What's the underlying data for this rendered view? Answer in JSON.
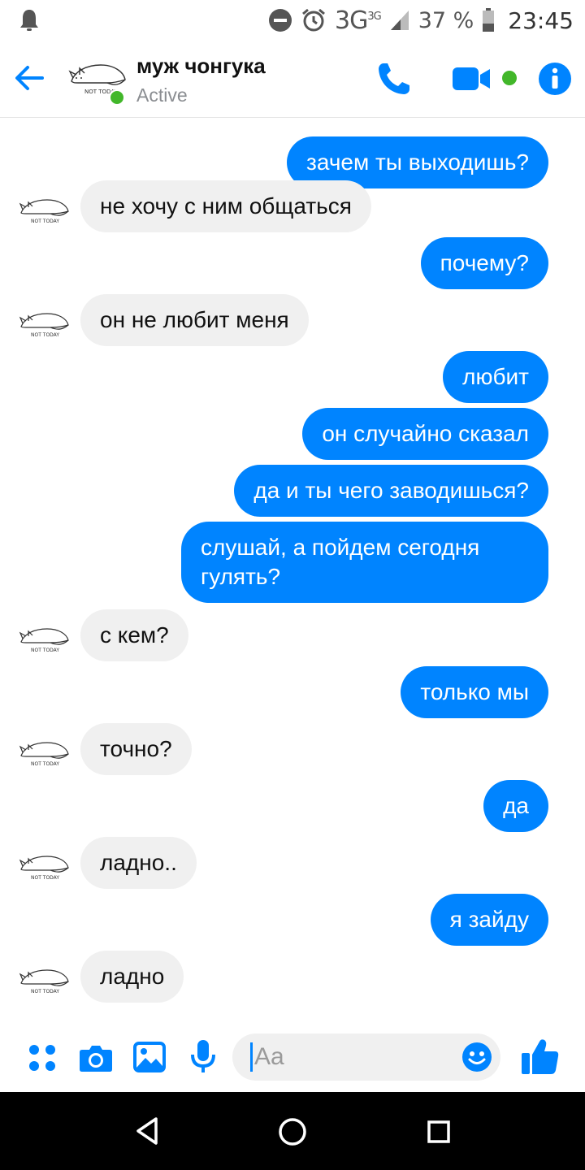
{
  "status_bar": {
    "network": "3G",
    "network_sup": "3G",
    "battery": "37 %",
    "time": "23:45"
  },
  "header": {
    "contact_name": "муж чонгука",
    "contact_status": "Active",
    "avatar_caption": "NOT TODAY"
  },
  "messages": [
    {
      "side": "out",
      "text": "зачем ты выходишь?"
    },
    {
      "side": "in",
      "text": "не хочу с ним общаться"
    },
    {
      "side": "out",
      "text": "почему?"
    },
    {
      "side": "in",
      "text": "он не любит меня"
    },
    {
      "side": "out",
      "text": "любит"
    },
    {
      "side": "out",
      "text": "он случайно сказал"
    },
    {
      "side": "out",
      "text": "да и ты чего заводишься?"
    },
    {
      "side": "out",
      "text": "слушай, а пойдем сегодня гулять?"
    },
    {
      "side": "in",
      "text": "с кем?"
    },
    {
      "side": "out",
      "text": "только мы"
    },
    {
      "side": "in",
      "text": "точно?"
    },
    {
      "side": "out",
      "text": "да"
    },
    {
      "side": "in",
      "text": "ладно.."
    },
    {
      "side": "out",
      "text": "я зайду"
    },
    {
      "side": "in",
      "text": "ладно"
    }
  ],
  "composer": {
    "placeholder": "Aa"
  },
  "colors": {
    "accent": "#0084ff",
    "incoming_bubble": "#f0f0f0",
    "active_green": "#42b72a"
  },
  "icons": {
    "status_left": "notification-bell-icon",
    "dnd": "do-not-disturb-icon",
    "alarm": "alarm-icon",
    "signal": "signal-icon",
    "battery": "battery-icon",
    "back": "back-arrow-icon",
    "call": "phone-icon",
    "video": "video-camera-icon",
    "info": "info-icon",
    "apps": "four-dots-icon",
    "camera": "camera-icon",
    "gallery": "image-icon",
    "mic": "microphone-icon",
    "emoji": "smiley-icon",
    "like": "thumbs-up-icon",
    "nav_back": "nav-back-icon",
    "nav_home": "nav-home-icon",
    "nav_recent": "nav-recent-icon"
  }
}
